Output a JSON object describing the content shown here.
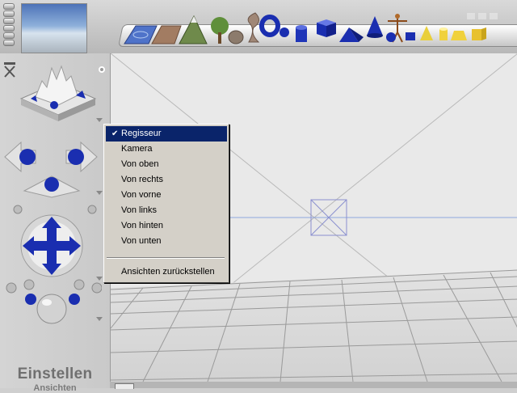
{
  "menu": {
    "checked_mark": "✔",
    "items": [
      {
        "label": "Regisseur",
        "selected": true
      },
      {
        "label": "Kamera"
      },
      {
        "label": "Von oben"
      },
      {
        "label": "Von rechts"
      },
      {
        "label": "Von vorne"
      },
      {
        "label": "Von links"
      },
      {
        "label": "Von hinten"
      },
      {
        "label": "Von unten"
      }
    ],
    "reset_label": "Ansichten zurückstellen"
  },
  "panel": {
    "title": "Einstellen",
    "subtitle": "Ansichten"
  },
  "shelf": {
    "items": [
      "water-icon",
      "terrain-icon",
      "mountain-icon",
      "tree-icon",
      "rock-icon",
      "twisted-shape-icon",
      "torus-icon",
      "cylinder-icon",
      "cube-icon",
      "pyramid-icon",
      "cone-icon",
      "human-figure-icon",
      "sphere-icon",
      "box-icon",
      "light-cone-icon",
      "light-icon",
      "light-icon",
      "light-icon"
    ]
  },
  "colors": {
    "accent_blue": "#1a2eb0",
    "menu_highlight": "#0a246a",
    "annotation_arrow": "#1a2eb0"
  }
}
